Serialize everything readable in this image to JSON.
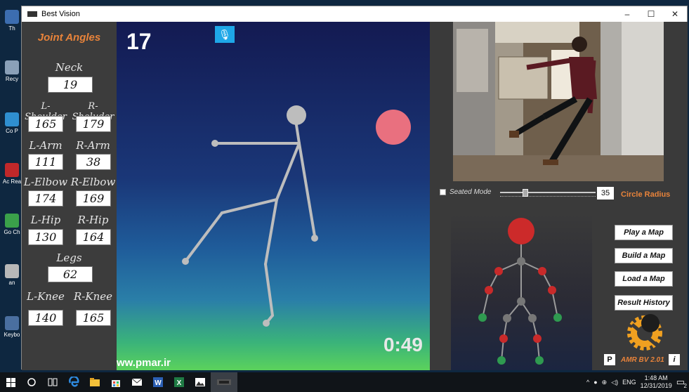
{
  "window": {
    "title": "Best Vision",
    "minimize_glyph": "–",
    "maximize_glyph": "☐",
    "close_glyph": "✕"
  },
  "desktop_icons": [
    "Th",
    "Recy",
    "Co P",
    "Ac Rea",
    "Go Ch",
    "an",
    "Keybo"
  ],
  "left_panel": {
    "title": "Joint Angles",
    "neck": {
      "label": "Neck",
      "value": "19"
    },
    "shoulders": {
      "left_label": "L-Shoulder",
      "right_label": "R-Sholuder",
      "left_value": "165",
      "right_value": "179"
    },
    "arms": {
      "left_label": "L-Arm",
      "right_label": "R-Arm",
      "left_value": "111",
      "right_value": "38"
    },
    "elbows": {
      "left_label": "L-Elbow",
      "right_label": "R-Elbow",
      "left_value": "174",
      "right_value": "169"
    },
    "hips": {
      "left_label": "L-Hip",
      "right_label": "R-Hip",
      "left_value": "130",
      "right_value": "164"
    },
    "legs": {
      "label": "Legs",
      "value": "62"
    },
    "knees": {
      "left_label": "L-Knee",
      "right_label": "R-Knee",
      "left_value": "140",
      "right_value": "165"
    }
  },
  "game": {
    "score": "17",
    "timer": "0:49",
    "website": "ww.pmar.ir",
    "mic_glyph": "🎙",
    "target_color": "#e9707f",
    "figure_color": "#bdbdbd"
  },
  "controls": {
    "seated_mode_label": "Seated Mode",
    "seated_checked": false,
    "radius_value": "35",
    "radius_label": "Circle Radius",
    "radius_level": 0.25
  },
  "buttons": {
    "play": "Play a Map",
    "build": "Build a Map",
    "load": "Load a Map",
    "history": "Result History"
  },
  "footer": {
    "p_label": "P",
    "version": "AMR BV 2.01",
    "info_label": "i"
  },
  "skeleton_colors": {
    "head": "#cc2a2a",
    "red_joint": "#c82a2a",
    "gray_joint": "#777777",
    "green_joint": "#2f9a50",
    "bone": "#9a9a9a"
  },
  "taskbar": {
    "icons": [
      "windows-icon",
      "search-icon",
      "task-view-icon",
      "edge-icon",
      "file-explorer-icon",
      "store-icon",
      "mail-icon",
      "word-icon",
      "excel-icon",
      "photos-icon",
      "app-icon"
    ],
    "language": "ENG",
    "time": "1:48 AM",
    "date": "12/31/2019",
    "notification_count": "2"
  }
}
